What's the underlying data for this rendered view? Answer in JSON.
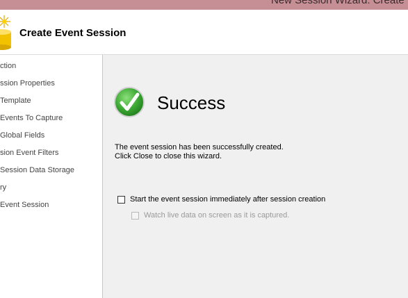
{
  "window": {
    "title": "New Session Wizard: Create E"
  },
  "header": {
    "title": "Create Event Session",
    "icon": "database-star-icon"
  },
  "sidebar": {
    "items": [
      {
        "label": "ction"
      },
      {
        "label": "ssion Properties"
      },
      {
        "label": " Template"
      },
      {
        "label": "Events To Capture"
      },
      {
        "label": " Global Fields"
      },
      {
        "label": "sion Event Filters"
      },
      {
        "label": " Session Data Storage"
      },
      {
        "label": "ry"
      },
      {
        "label": "Event Session"
      }
    ]
  },
  "main": {
    "status_icon": "success-checkmark-icon",
    "status": "Success",
    "message_line1": "The event session has been successfully created.",
    "message_line2": "Click Close to close this wizard.",
    "start_session": {
      "label": "Start the event session immediately after session creation",
      "checked": false
    },
    "watch_live": {
      "label": "Watch live data on screen as it is captured.",
      "checked": false,
      "enabled": false
    }
  },
  "colors": {
    "titlebar": "#c68f95",
    "success_green": "#3aa531"
  }
}
